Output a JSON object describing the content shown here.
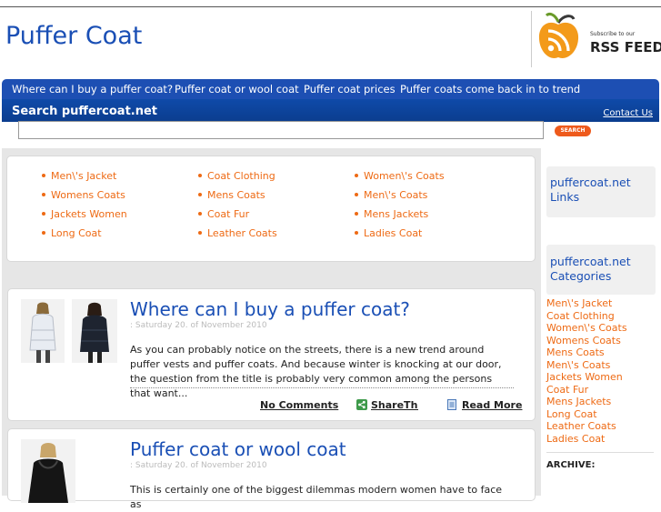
{
  "header": {
    "site_title": "Puffer Coat",
    "rss_subscribe": "Subscribe to our",
    "rss_feed": "RSS FEED"
  },
  "nav": {
    "items": [
      "Where can I buy a puffer coat?",
      "Puffer coat or wool coat",
      "Puffer coat prices",
      "Puffer coats come back in to trend"
    ]
  },
  "search": {
    "title": "Search puffercoat.net",
    "contact": "Contact Us",
    "input_value": "",
    "button_label": "SEARCH"
  },
  "tags": {
    "columns": [
      [
        "Men\\'s Jacket",
        "Womens Coats",
        "Jackets Women",
        "Long Coat"
      ],
      [
        "Coat Clothing",
        "Mens Coats",
        "Coat Fur",
        "Leather Coats"
      ],
      [
        "Women\\'s Coats",
        "Men\\'s Coats",
        "Mens Jackets",
        "Ladies Coat"
      ]
    ]
  },
  "posts": [
    {
      "title": "Where can I buy a puffer coat?",
      "date": ": Saturday 20. of November 2010",
      "excerpt": "As you can probably notice on the streets, there is a new trend around puffer vests and puffer coats. And because winter is knocking at our door, the question from the title is probably very common among the persons that want...",
      "comments": "No Comments",
      "share": "ShareThis",
      "read_more": "Read More"
    },
    {
      "title": "Puffer coat or wool coat",
      "date": ": Saturday 20. of November 2010",
      "excerpt": "This is certainly one of the biggest dilemmas modern women have to face as"
    }
  ],
  "sidebar": {
    "links_heading": "puffercoat.net Links",
    "categories_heading": "puffercoat.net Categories",
    "categories": [
      "Men\\'s Jacket",
      "Coat Clothing",
      "Women\\'s Coats",
      "Womens Coats",
      "Mens Coats",
      "Men\\'s Coats",
      "Jackets Women",
      "Coat Fur",
      "Mens Jackets",
      "Long Coat",
      "Leather Coats",
      "Ladies Coat"
    ],
    "archive_heading": "ARCHIVE:"
  },
  "colors": {
    "brand_blue": "#1a4fb5",
    "nav_blue": "#1d4fb3",
    "accent_orange": "#ee6a14"
  }
}
